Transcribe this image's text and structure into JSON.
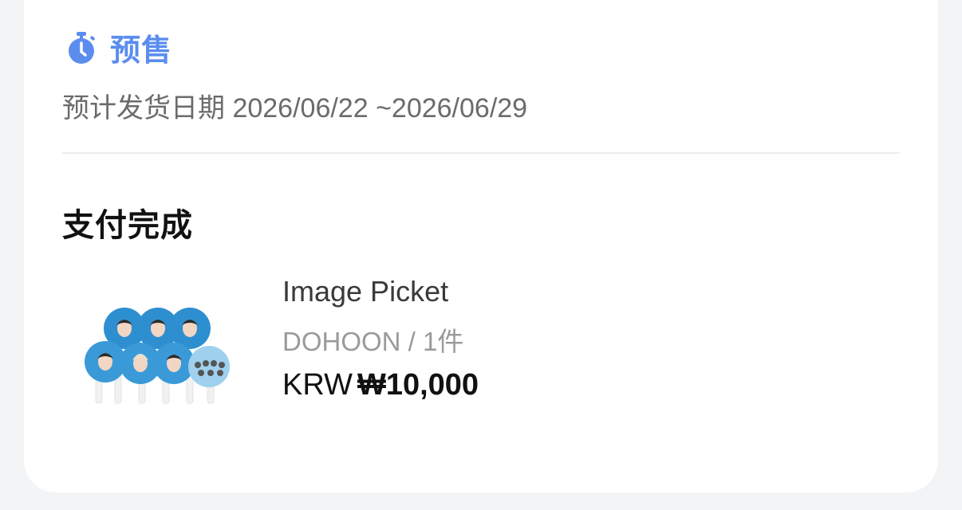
{
  "presale": {
    "label": "预售",
    "icon": "stopwatch-icon",
    "color": "#5b8def"
  },
  "shipping": {
    "label": "预计发货日期",
    "date_range": "2026/06/22 ~2026/06/29"
  },
  "order": {
    "status": "支付完成"
  },
  "product": {
    "name": "Image Picket",
    "option": "DOHOON",
    "separator": "/",
    "quantity": "1件",
    "currency": "KRW",
    "price": "₩10,000",
    "image": "picket-fan-thumbnail"
  }
}
